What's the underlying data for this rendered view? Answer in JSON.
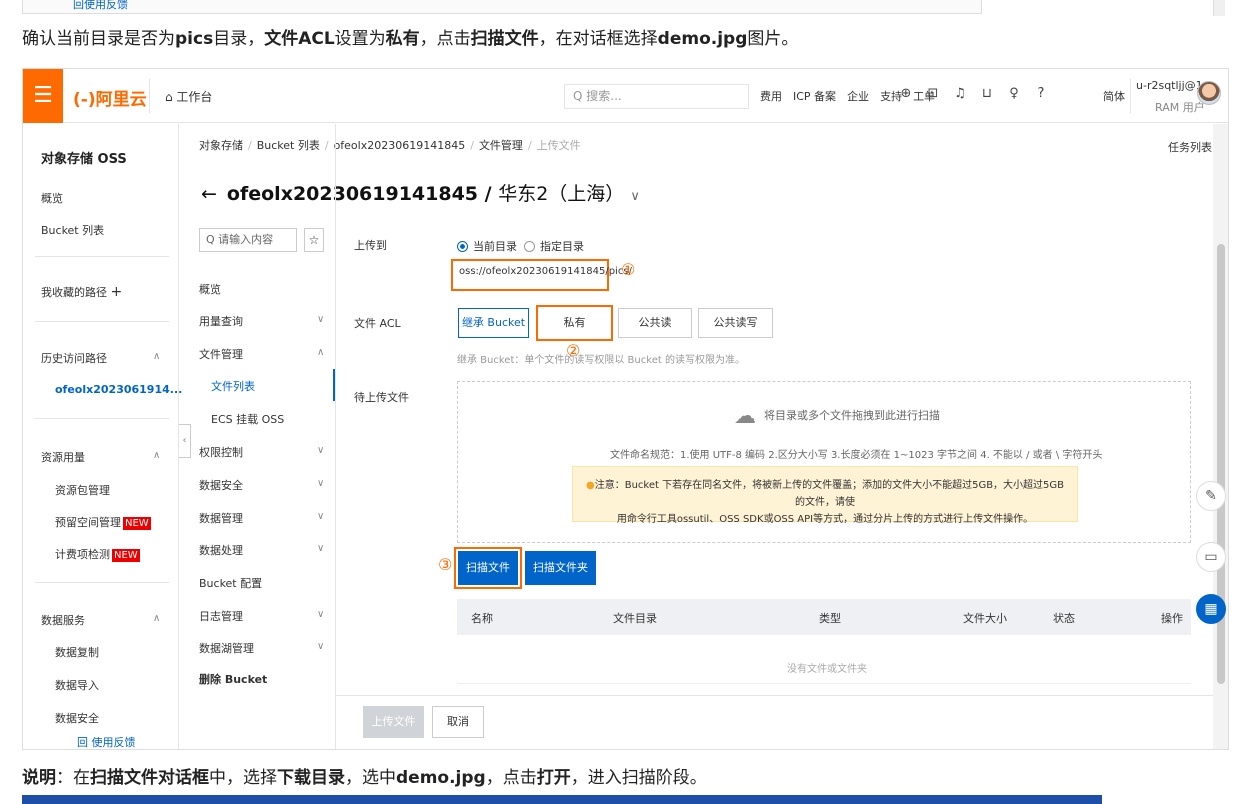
{
  "top_strip": {
    "link": "回使用反馈"
  },
  "doc1": {
    "p1": "确认当前目录是否为",
    "b1": "pics",
    "p2": "目录，",
    "b2": "文件ACL",
    "p3": "设置为",
    "b3": "私有",
    "p4": "，点击",
    "b4": "扫描文件",
    "p5": "，在对话框选择",
    "b5": "demo.jpg",
    "p6": "图片。"
  },
  "doc2": {
    "b1": "说明",
    "p1": "：在",
    "b2": "扫描文件对话框",
    "p2": "中，选择",
    "b3": "下载目录",
    "p3": "，选中",
    "b4": "demo.jpg",
    "p4": "，点击",
    "b5": "打开",
    "p5": "，进入扫描阶段。"
  },
  "topbar": {
    "menu_icon": "menu-icon",
    "logo": "(-)阿里云",
    "workbench": "⌂ 工作台",
    "search_placeholder": "Q 搜索...",
    "links": [
      "费用",
      "ICP 备案",
      "企业",
      "支持",
      "工单"
    ],
    "icons": [
      "⊕",
      "⊡",
      "♫",
      "⊔",
      "♀",
      "?"
    ],
    "lang": "简体",
    "user_name": "u-r2sqtljj@1...",
    "user_role": "RAM 用户"
  },
  "sidebar": {
    "title": "对象存储 OSS",
    "overview": "概览",
    "bucket_list": "Bucket 列表",
    "favorites": "我收藏的路径",
    "favorites_plus": "+",
    "history": "历史访问路径",
    "history_item": "ofeolx2023061914...",
    "resources": "资源用量",
    "res_items": [
      "资源包管理",
      "预留空间管理",
      "计费项检测"
    ],
    "new_badge": "NEW",
    "data_services": "数据服务",
    "data_items": [
      "数据复制",
      "数据导入",
      "数据安全"
    ],
    "feedback": "回 使用反馈"
  },
  "breadcrumb": [
    "对象存储",
    "Bucket 列表",
    "ofeolx20230619141845",
    "文件管理",
    "上传文件"
  ],
  "task_list": "任务列表",
  "page_title": {
    "back": "←",
    "name": "ofeolx20230619141845",
    "slash": " / ",
    "region": "华东2（上海）",
    "caret": "∨"
  },
  "subnav": {
    "search_placeholder": "Q 请输入内容",
    "star": "☆",
    "items": [
      "概览",
      "用量查询",
      "文件管理",
      "权限控制",
      "数据安全",
      "数据管理",
      "数据处理",
      "Bucket 配置",
      "日志管理",
      "数据湖管理",
      "删除 Bucket"
    ],
    "children": [
      "文件列表",
      "ECS 挂载 OSS"
    ]
  },
  "form": {
    "upload_to": "上传到",
    "radio_current": "当前目录",
    "radio_specified": "指定目录",
    "path": "oss://ofeolx20230619141845/pics/",
    "acl_label": "文件 ACL",
    "acl_options": [
      "继承 Bucket",
      "私有",
      "公共读",
      "公共读写"
    ],
    "acl_hint": "继承 Bucket：单个文件的读写权限以 Bucket 的读写权限为准。",
    "pending_label": "待上传文件",
    "dz_upload": "将目录或多个文件拖拽到此进行扫描",
    "dz_rules": "文件命名规范：1.使用 UTF-8 编码 2.区分大小写 3.长度必须在 1~1023 字节之间 4. 不能以 / 或者 \\ 字符开头",
    "dz_warn_1": "注意：Bucket 下若存在同名文件，将被新上传的文件覆盖；添加的文件大小不能超过5GB，大小超过5GB的文件，请使",
    "dz_warn_2": "用命令行工具ossutil、OSS SDK或OSS API等方式，通过分片上传的方式进行上传文件操作。",
    "scan_file": "扫描文件",
    "scan_folder": "扫描文件夹",
    "columns": [
      "名称",
      "文件目录",
      "类型",
      "文件大小",
      "状态",
      "操作"
    ],
    "empty": "没有文件或文件夹",
    "upload_btn": "上传文件",
    "cancel_btn": "取消"
  },
  "annotations": {
    "n1": "①",
    "n2": "②",
    "n3": "③"
  },
  "float_icons": [
    "edit-icon",
    "chat-icon",
    "apps-icon"
  ],
  "colors": {
    "brand": "#ff6a00",
    "primary": "#0064c8",
    "highlight": "#ff6a00",
    "warn_bg": "#fff3d6"
  }
}
